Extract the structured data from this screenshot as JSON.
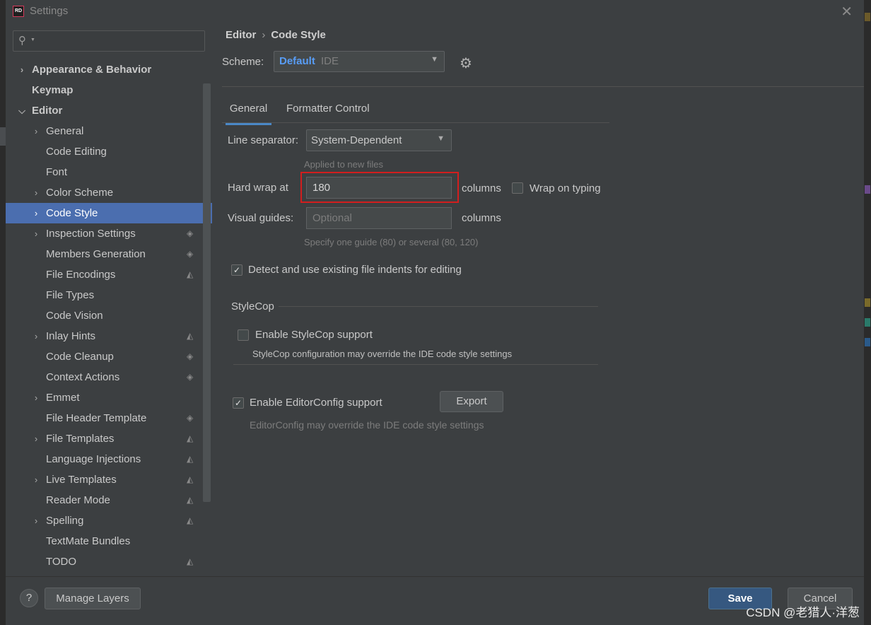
{
  "window": {
    "title": "Settings",
    "app_icon": "RD"
  },
  "sidebar": {
    "search_placeholder": "",
    "items": [
      {
        "label": "Appearance & Behavior",
        "level": 0,
        "expander": "collapsed",
        "bold": true
      },
      {
        "label": "Keymap",
        "level": 0,
        "expander": "none",
        "bold": true
      },
      {
        "label": "Editor",
        "level": 0,
        "expander": "expanded",
        "bold": true
      },
      {
        "label": "General",
        "level": 1,
        "expander": "collapsed"
      },
      {
        "label": "Code Editing",
        "level": 1,
        "expander": "none"
      },
      {
        "label": "Font",
        "level": 1,
        "expander": "none"
      },
      {
        "label": "Color Scheme",
        "level": 1,
        "expander": "collapsed"
      },
      {
        "label": "Code Style",
        "level": 1,
        "expander": "collapsed",
        "selected": true
      },
      {
        "label": "Inspection Settings",
        "level": 1,
        "expander": "collapsed",
        "layer": "stack"
      },
      {
        "label": "Members Generation",
        "level": 1,
        "expander": "none",
        "layer": "stack"
      },
      {
        "label": "File Encodings",
        "level": 1,
        "expander": "none",
        "layer": "single"
      },
      {
        "label": "File Types",
        "level": 1,
        "expander": "none"
      },
      {
        "label": "Code Vision",
        "level": 1,
        "expander": "none"
      },
      {
        "label": "Inlay Hints",
        "level": 1,
        "expander": "collapsed",
        "layer": "single"
      },
      {
        "label": "Code Cleanup",
        "level": 1,
        "expander": "none",
        "layer": "stack"
      },
      {
        "label": "Context Actions",
        "level": 1,
        "expander": "none",
        "layer": "stack"
      },
      {
        "label": "Emmet",
        "level": 1,
        "expander": "collapsed"
      },
      {
        "label": "File Header Template",
        "level": 1,
        "expander": "none",
        "layer": "stack"
      },
      {
        "label": "File Templates",
        "level": 1,
        "expander": "collapsed",
        "layer": "single"
      },
      {
        "label": "Language Injections",
        "level": 1,
        "expander": "none",
        "layer": "single"
      },
      {
        "label": "Live Templates",
        "level": 1,
        "expander": "collapsed",
        "layer": "single"
      },
      {
        "label": "Reader Mode",
        "level": 1,
        "expander": "none",
        "layer": "single"
      },
      {
        "label": "Spelling",
        "level": 1,
        "expander": "collapsed",
        "layer": "single"
      },
      {
        "label": "TextMate Bundles",
        "level": 1,
        "expander": "none"
      },
      {
        "label": "TODO",
        "level": 1,
        "expander": "none",
        "layer": "single"
      }
    ]
  },
  "breadcrumb": {
    "parent": "Editor",
    "current": "Code Style"
  },
  "scheme": {
    "label": "Scheme:",
    "name": "Default",
    "type": "IDE"
  },
  "tabs": [
    {
      "label": "General",
      "active": true
    },
    {
      "label": "Formatter Control",
      "active": false
    }
  ],
  "general": {
    "line_separator_label": "Line separator:",
    "line_separator_value": "System-Dependent",
    "applied_hint": "Applied to new files",
    "hard_wrap_label": "Hard wrap at",
    "hard_wrap_value": "180",
    "columns_label": "columns",
    "wrap_on_typing_label": "Wrap on typing",
    "wrap_on_typing_checked": false,
    "visual_guides_label": "Visual guides:",
    "visual_guides_placeholder": "Optional",
    "visual_guides_hint": "Specify one guide (80) or several (80, 120)",
    "detect_indents_label": "Detect and use existing file indents for editing",
    "detect_indents_checked": true
  },
  "stylecop": {
    "group_title": "StyleCop",
    "enable_label": "Enable StyleCop support",
    "enable_checked": false,
    "hint": "StyleCop configuration may override the IDE code style settings"
  },
  "editorconfig": {
    "enable_label": "Enable EditorConfig support",
    "enable_checked": true,
    "export_label": "Export",
    "hint": "EditorConfig may override the IDE code style settings"
  },
  "footer": {
    "help_label": "?",
    "manage_layers_label": "Manage Layers",
    "save_label": "Save",
    "cancel_label": "Cancel"
  },
  "watermark": "CSDN @老猎人·洋葱",
  "colors": {
    "selection": "#4b6eaf",
    "accent": "#589df6",
    "highlight_box": "#d21e1e",
    "save_button": "#365880"
  }
}
